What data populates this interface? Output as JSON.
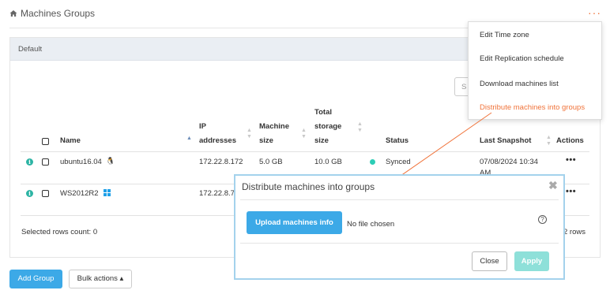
{
  "header": {
    "title": "Machines Groups",
    "home_icon": "home-icon",
    "more_label": "···"
  },
  "panel": {
    "group_name": "Default",
    "search_placeholder": "S"
  },
  "table": {
    "columns": {
      "name": "Name",
      "ip": [
        "IP",
        "addresses"
      ],
      "size": [
        "Machine",
        "size"
      ],
      "total": [
        "Total",
        "storage",
        "size"
      ],
      "status": "Status",
      "snapshot": "Last Snapshot",
      "actions": "Actions"
    },
    "rows": [
      {
        "name": "ubuntu16.04",
        "os_icon": "linux-icon",
        "ip": "172.22.8.172",
        "size": "5.0 GB",
        "total": "10.0 GB",
        "status": "Synced",
        "status_color": "#2ccdb6",
        "snapshot": [
          "07/08/2024 10:34",
          "AM"
        ],
        "actions": "•••"
      },
      {
        "name": "WS2012R2",
        "os_icon": "windows-icon",
        "ip": "172.22.8.7",
        "actions": "•••"
      }
    ]
  },
  "footer": {
    "selected": "Selected rows count: 0",
    "rows": "2 rows"
  },
  "buttons": {
    "add_group": "Add Group",
    "bulk_actions": "Bulk actions ▴"
  },
  "menu": {
    "items": [
      {
        "label": "Edit Time zone"
      },
      {
        "label": "Edit Replication schedule"
      },
      {
        "label": "Download machines list"
      },
      {
        "label": "Distribute machines into groups"
      }
    ],
    "highlight_color": "#f0733a"
  },
  "modal": {
    "title": "Distribute machines into groups",
    "close_symbol": "✖",
    "upload_label": "Upload machines info",
    "file_status": "No file chosen",
    "help_symbol": "?",
    "close_label": "Close",
    "apply_label": "Apply"
  },
  "colors": {
    "accent": "#3ca9e7",
    "orange": "#f0733a",
    "status_synced": "#2ccdb6",
    "apply_disabled": "#8ee0d9"
  }
}
